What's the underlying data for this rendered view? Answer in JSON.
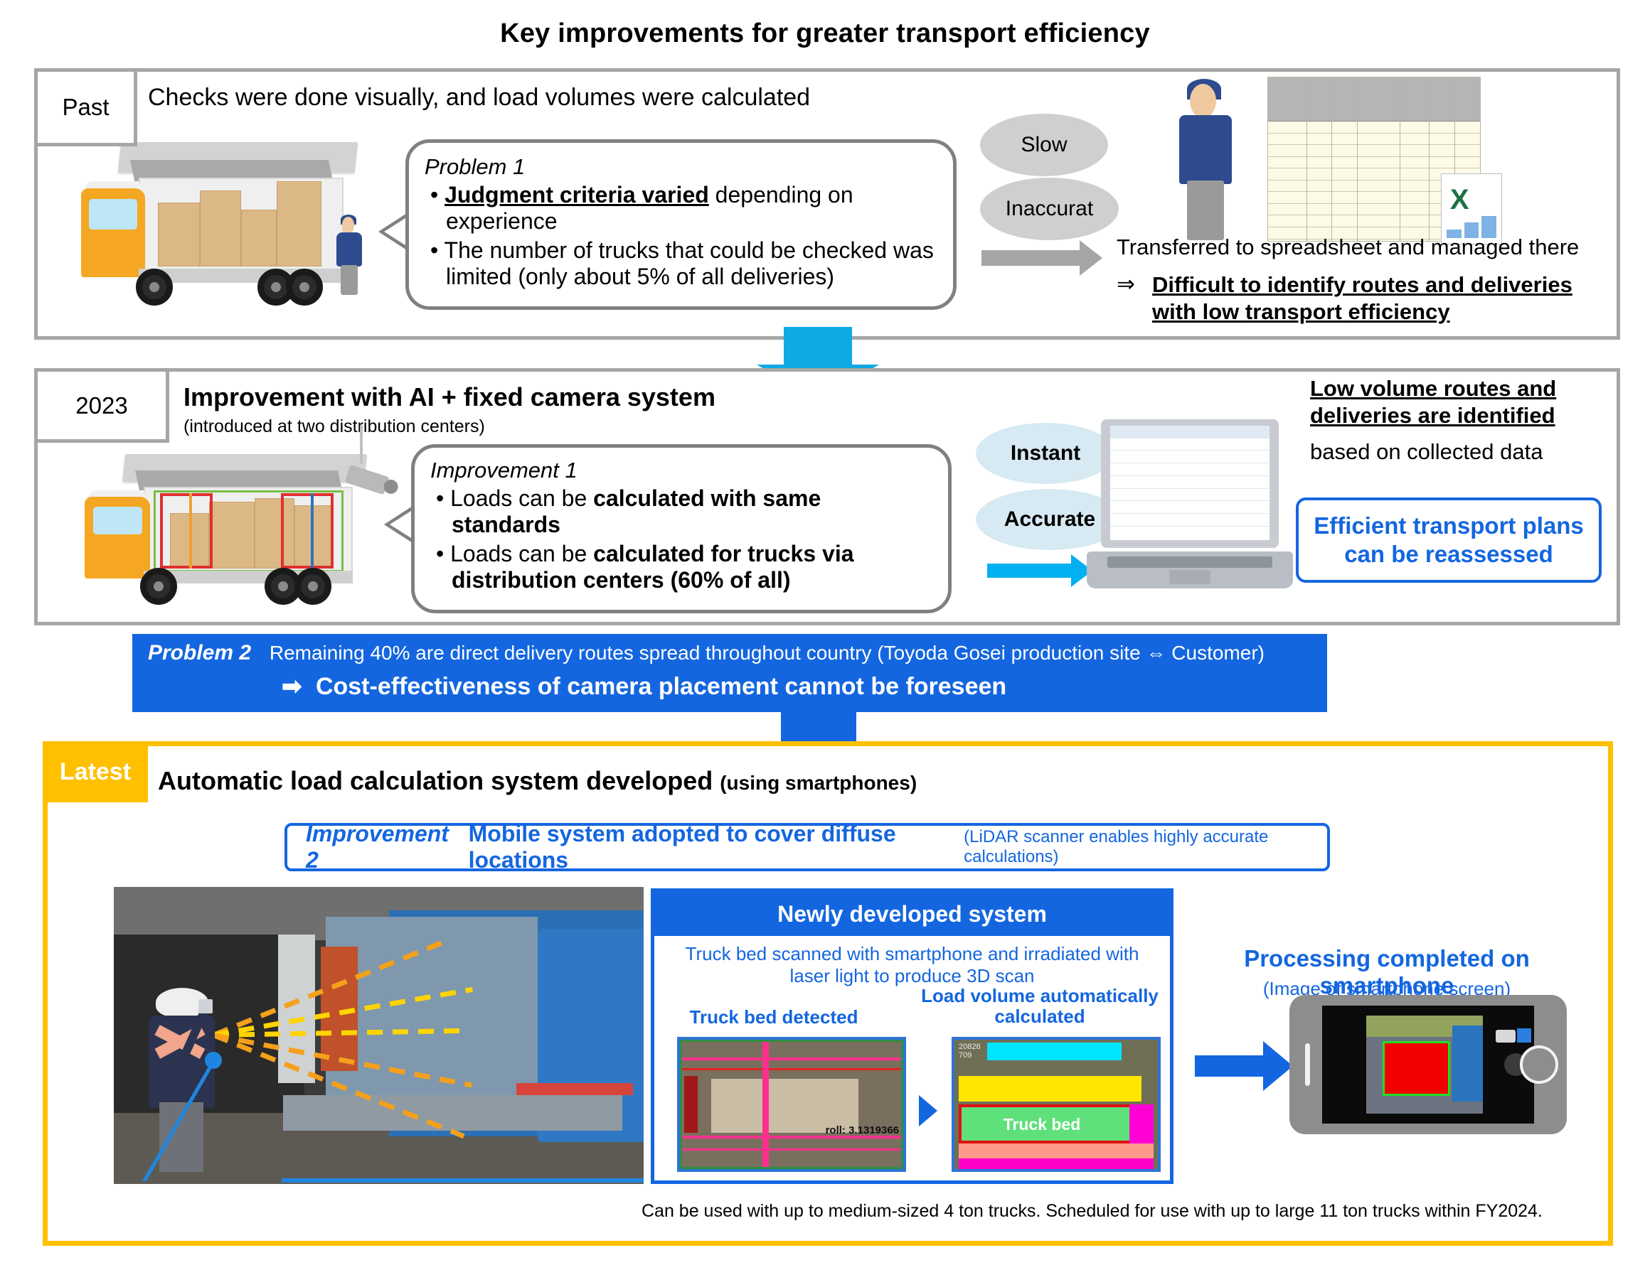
{
  "title": "Key improvements for greater transport efficiency",
  "past": {
    "tag": "Past",
    "headline": "Checks were done visually, and load volumes were calculated",
    "problem": {
      "label": "Problem 1",
      "bullets": [
        {
          "strong": "Judgment criteria varied",
          "rest": " depending on experience"
        },
        {
          "strong": "",
          "rest": "The number of trucks that could be checked was limited (only about 5% of all deliveries)"
        }
      ]
    },
    "pills": [
      "Slow",
      "Inaccurat"
    ],
    "transfer_text": "Transferred to spreadsheet and managed there",
    "result_arrow": "⇒",
    "result_text": "Difficult to identify routes and deliveries with low transport efficiency"
  },
  "y2023": {
    "tag": "2023",
    "headline": "Improvement with AI + fixed camera system",
    "subhead": "(introduced at two distribution centers)",
    "improvement": {
      "label": "Improvement 1",
      "bullets": [
        {
          "plain": "Loads can be ",
          "strong": "calculated with same standards"
        },
        {
          "plain": "Loads can be ",
          "strong": "calculated for trucks via distribution centers (60% of all)"
        }
      ]
    },
    "pills": [
      "Instant",
      "Accurate"
    ],
    "result_underline": "Low volume routes and deliveries are identified",
    "result_rest": "based on collected data",
    "callout": "Efficient transport plans can be reassessed"
  },
  "problem2": {
    "label": "Problem 2",
    "line1": "Remaining 40% are direct delivery routes spread throughout country (Toyoda Gosei production site ⇔ Customer)",
    "arrow": "➡",
    "line2": "Cost-effectiveness of camera placement cannot be foreseen"
  },
  "latest": {
    "tag": "Latest",
    "headline": "Automatic load calculation system developed",
    "headline_small": "(using smartphones)",
    "improvement2": {
      "label": "Improvement 2",
      "main": "Mobile system adopted to cover diffuse locations",
      "note": "(LiDAR scanner enables highly accurate calculations)"
    },
    "nds": {
      "header": "Newly developed system",
      "description": "Truck bed scanned with smartphone and irradiated with laser light to produce 3D scan",
      "left_label": "Truck bed detected",
      "right_label": "Load volume automatically calculated",
      "scan_overlay_text": "roll: 3.1319366",
      "volume_overlay_text": "Truck bed",
      "volume_corner_text": "20828\n709"
    },
    "phone": {
      "title": "Processing completed on smartphone",
      "subtitle": "(Image of smartphone screen)"
    },
    "footnote": "Can be used with up to medium-sized 4 ton trucks. Scheduled for use with up to large 11 ton trucks within FY2024."
  },
  "colors": {
    "blue": "#1466e0",
    "cyan": "#0fa9e6",
    "amber": "#ffc000",
    "grey": "#a6a6a6",
    "pill_grey": "#cfcfcf",
    "pill_blue": "#d7e9f2"
  }
}
